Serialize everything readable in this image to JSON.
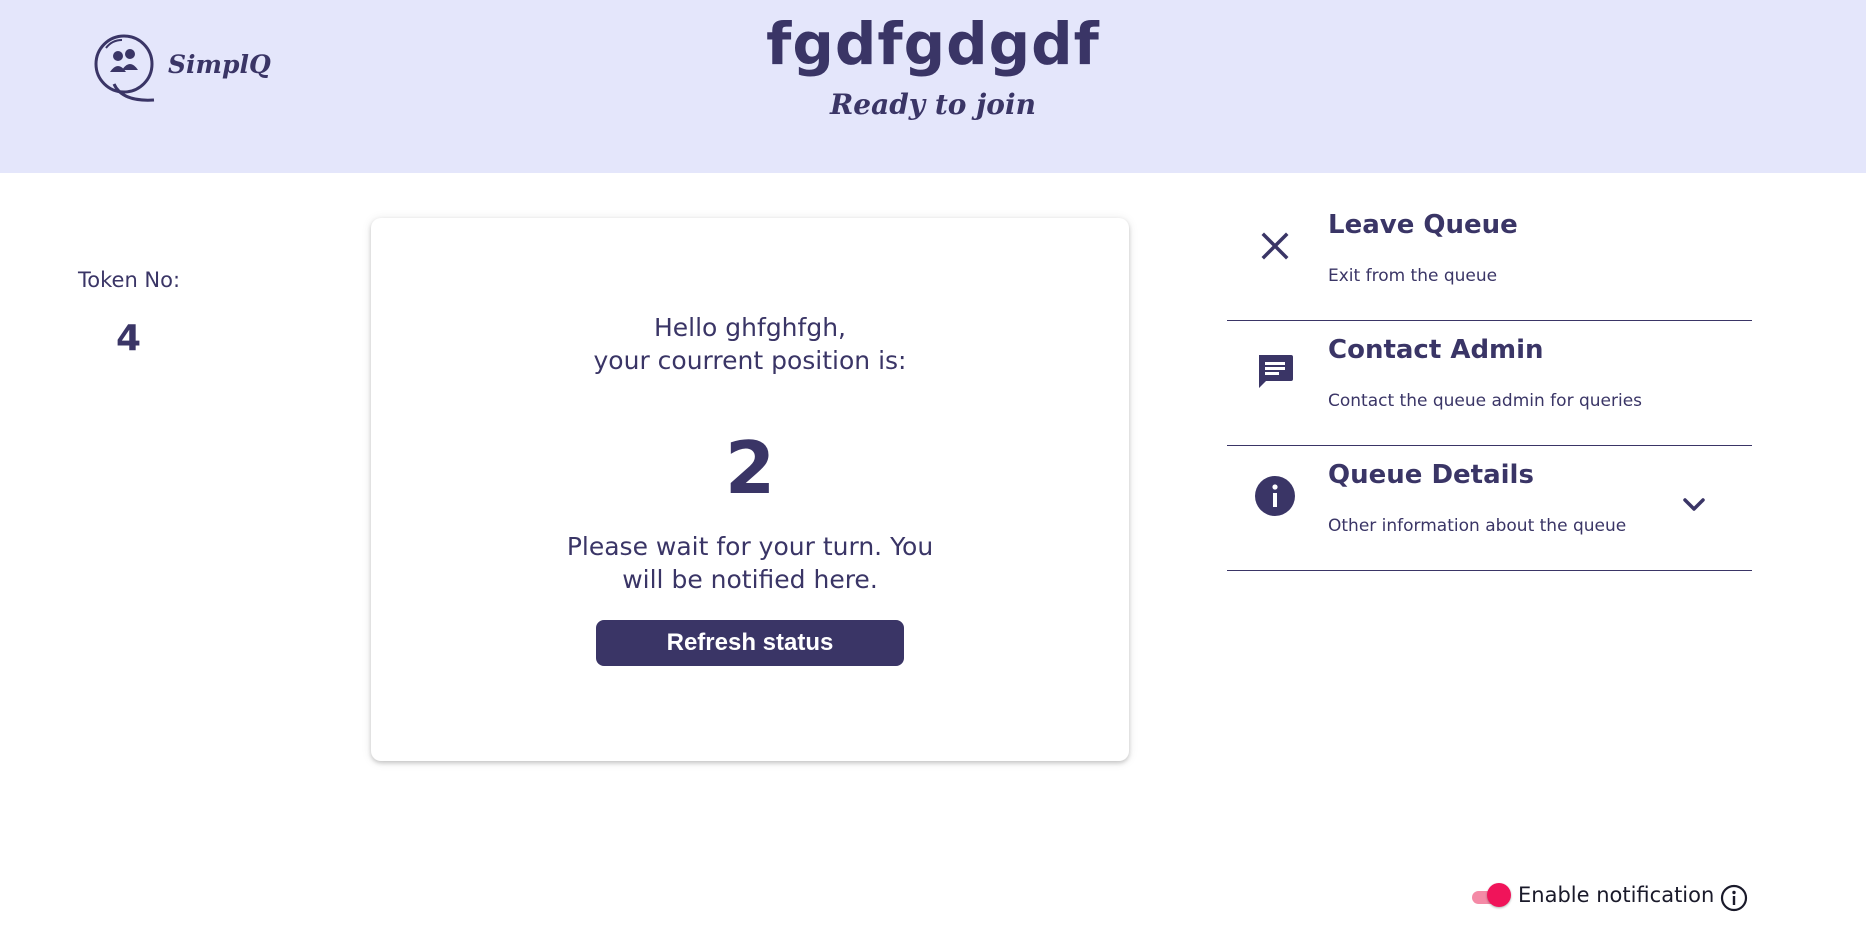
{
  "header": {
    "logo_text": "SimplQ",
    "queue_name": "fgdfgdgdf",
    "status": "Ready to join"
  },
  "token": {
    "label": "Token No:",
    "value": "4"
  },
  "status_card": {
    "greeting_line1": "Hello ghfghfgh,",
    "greeting_line2": "your courrent position is:",
    "position": "2",
    "wait_message": "Please wait for your turn. You will be notified here.",
    "refresh_label": "Refresh status"
  },
  "actions": [
    {
      "icon": "close-icon",
      "title": "Leave Queue",
      "description": "Exit from the queue"
    },
    {
      "icon": "chat-icon",
      "title": "Contact Admin",
      "description": "Contact the queue admin for queries"
    },
    {
      "icon": "info-icon",
      "title": "Queue Details",
      "description": "Other information about the queue"
    }
  ],
  "notification": {
    "label": "Enable notification",
    "enabled": true
  },
  "colors": {
    "primary": "#3a3566",
    "header_bg": "#e4e6fb",
    "toggle_on": "#f0145a"
  }
}
